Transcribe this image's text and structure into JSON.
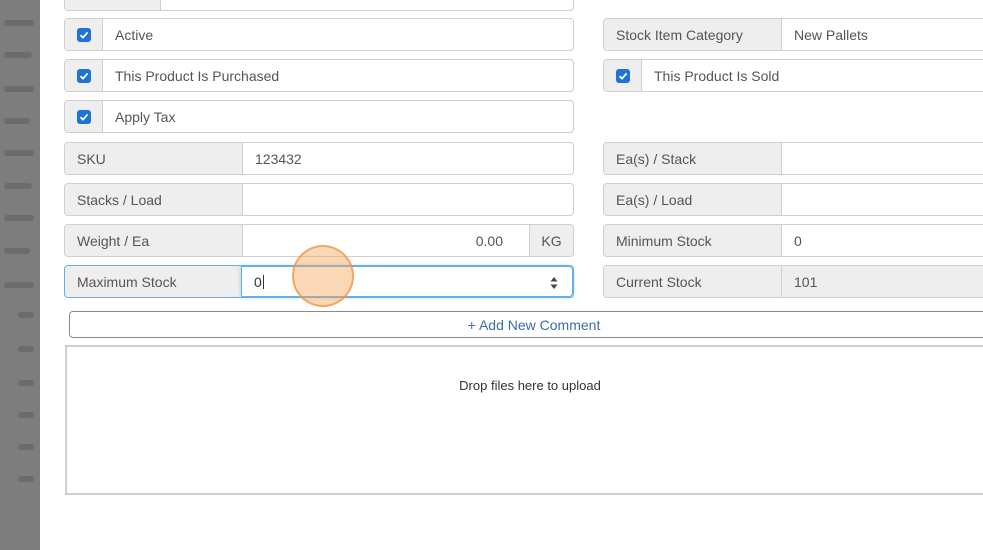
{
  "checkboxes": {
    "active": {
      "label": "Active",
      "checked": true
    },
    "purchased": {
      "label": "This Product Is Purchased",
      "checked": true
    },
    "apply_tax": {
      "label": "Apply Tax",
      "checked": true
    },
    "sold": {
      "label": "This Product Is Sold",
      "checked": true
    }
  },
  "fields": {
    "stock_item_category": {
      "label": "Stock Item Category",
      "value": "New Pallets"
    },
    "sku": {
      "label": "SKU",
      "value": "123432"
    },
    "eas_stack": {
      "label": "Ea(s) / Stack",
      "value": ""
    },
    "stacks_load": {
      "label": "Stacks / Load",
      "value": ""
    },
    "eas_load": {
      "label": "Ea(s) / Load",
      "value": ""
    },
    "weight_ea": {
      "label": "Weight / Ea",
      "value": "0.00",
      "unit": "KG"
    },
    "minimum_stock": {
      "label": "Minimum Stock",
      "value": "0"
    },
    "maximum_stock": {
      "label": "Maximum Stock",
      "value": "0"
    },
    "current_stock": {
      "label": "Current Stock",
      "value": "101"
    }
  },
  "comments": {
    "add_label": "+ Add New Comment"
  },
  "upload": {
    "dropzone_text": "Drop files here to upload"
  },
  "colors": {
    "checkbox": "#1e73d8",
    "link": "#3a6ea5",
    "focus": "#66afe9",
    "cursor_highlight": "#f5a65a"
  }
}
